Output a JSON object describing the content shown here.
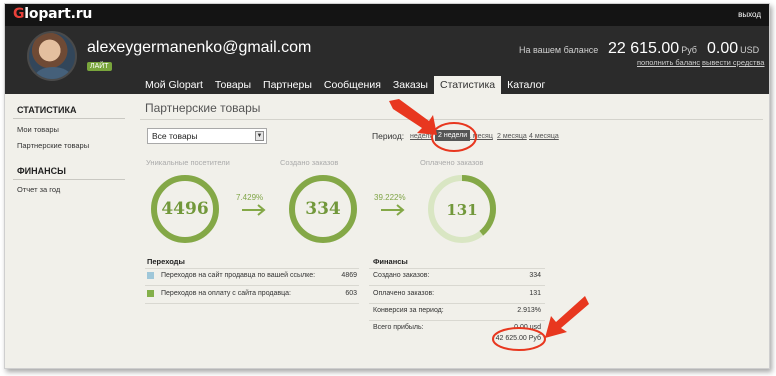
{
  "header": {
    "logo_prefix": "G",
    "logo_rest": "lopart.ru",
    "exit": "выход"
  },
  "user": {
    "email": "alexeygermanenko@gmail.com",
    "badge": "ЛАЙТ"
  },
  "balance": {
    "label": "На вашем балансе",
    "rub_value": "22 615.00",
    "rub_currency": "Руб",
    "usd_value": "0.00",
    "usd_currency": "USD",
    "topup_link": "пополнить баланс",
    "withdraw_link": "вывести средства"
  },
  "tabs": [
    {
      "label": "Мой Glopart",
      "active": false
    },
    {
      "label": "Товары",
      "active": false
    },
    {
      "label": "Партнеры",
      "active": false
    },
    {
      "label": "Сообщения",
      "active": false
    },
    {
      "label": "Заказы",
      "active": false
    },
    {
      "label": "Статистика",
      "active": true
    },
    {
      "label": "Каталог",
      "active": false
    }
  ],
  "sidebar": {
    "section1_title": "СТАТИСТИКА",
    "section1_items": [
      "Мои товары",
      "Партнерские товары"
    ],
    "section2_title": "ФИНАНСЫ",
    "section2_items": [
      "Отчет за год"
    ]
  },
  "content": {
    "title": "Партнерские товары",
    "product_select": "Все товары",
    "period_label": "Период:",
    "period_options": [
      "неделя",
      "2 недели",
      "1 месяц",
      "2 месяца",
      "4 месяца"
    ],
    "period_selected": "2 недели"
  },
  "stats": {
    "visitors_label": "Уникальные посетители",
    "visitors": "4496",
    "orders_label": "Создано заказов",
    "orders": "334",
    "paid_label": "Оплачено заказов",
    "paid": "131",
    "paid_fraction": 0.392,
    "conv1": "7.429%",
    "conv2": "39.222%"
  },
  "transitions": {
    "title": "Переходы",
    "rows": [
      {
        "label": "Переходов на сайт продавца по вашей ссылке:",
        "value": "4869",
        "color": "#9fc7d9"
      },
      {
        "label": "Переходов на оплату с сайта продавца:",
        "value": "603",
        "color": "#84b04a"
      }
    ]
  },
  "finances": {
    "title": "Финансы",
    "rows": [
      {
        "label": "Создано заказов:",
        "value": "334"
      },
      {
        "label": "Оплачено заказов:",
        "value": "131"
      },
      {
        "label": "Конверсия за период:",
        "value": "2.913%"
      },
      {
        "label": "Всего прибыль:",
        "value": "0.00 usd"
      }
    ],
    "profit_rub": "42 625.00 Руб"
  },
  "colors": {
    "accent_green": "#84a847",
    "annotation_red": "#e8371f",
    "header_dark": "#2b2b2b"
  }
}
